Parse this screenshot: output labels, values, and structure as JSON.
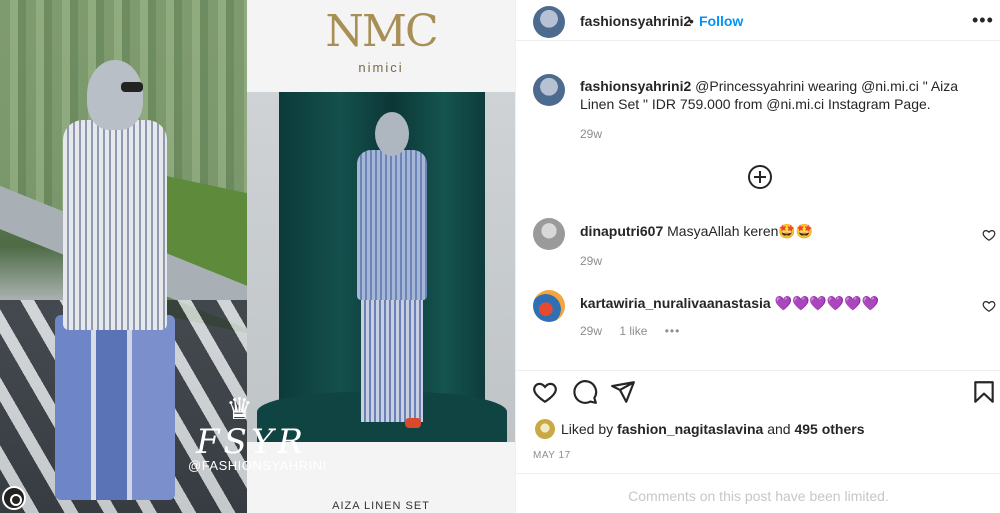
{
  "media": {
    "brand_logo": "NMC",
    "brand_name": "nimici",
    "product_caption": "AIZA LINEN SET",
    "watermark_crown": "♛",
    "watermark_mono": "FSYR",
    "watermark_handle": "@FASHIONSYAHRINI"
  },
  "header": {
    "username": "fashionsyahrini2",
    "separator": "•",
    "follow_label": "Follow",
    "more_glyph": "•••"
  },
  "caption": {
    "username": "fashionsyahrini2",
    "text": "@Princessyahrini wearing @ni.mi.ci \" Aiza Linen Set \" IDR 759.000 from @ni.mi.ci Instagram Page.",
    "time": "29w"
  },
  "comments": [
    {
      "username": "dinaputri607",
      "text": "MasyaAllah keren🤩🤩",
      "time": "29w"
    },
    {
      "username": "kartawiria_nuralivaanastasia",
      "text": "💜💜💜💜💜💜",
      "time": "29w",
      "likes": "1 like",
      "options": "•••"
    }
  ],
  "likes": {
    "prefix": "Liked by",
    "user": "fashion_nagitaslavina",
    "joiner": "and",
    "others": "495 others"
  },
  "date": "MAY 17",
  "limited_notice": "Comments on this post have been limited.",
  "colors": {
    "accent": "#0095f6",
    "text": "#262626",
    "muted": "#8e8e8e",
    "border": "#efefef"
  },
  "icons": [
    "like-icon",
    "comment-icon",
    "share-icon",
    "save-icon",
    "load-more-icon",
    "more-options-icon"
  ]
}
